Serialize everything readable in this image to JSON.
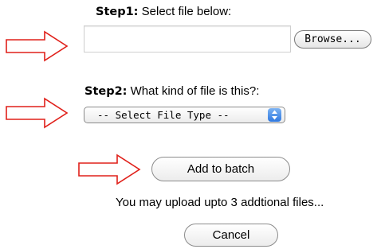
{
  "step1": {
    "label_bold": "Step1:",
    "label_text": " Select file below:",
    "browse_label": "Browse..."
  },
  "step2": {
    "label_bold": "Step2:",
    "label_text": " What kind of file is this?:",
    "select_value": "-- Select File Type --"
  },
  "actions": {
    "add_to_batch_label": "Add to batch",
    "cancel_label": "Cancel"
  },
  "info": {
    "remaining_text": "You may upload upto 3 addtional files..."
  },
  "colors": {
    "arrow_stroke": "#e0201a",
    "select_accent": "#2f78e0"
  },
  "icons": {
    "arrow": "right-arrow-icon",
    "stepper": "select-stepper-icon"
  }
}
